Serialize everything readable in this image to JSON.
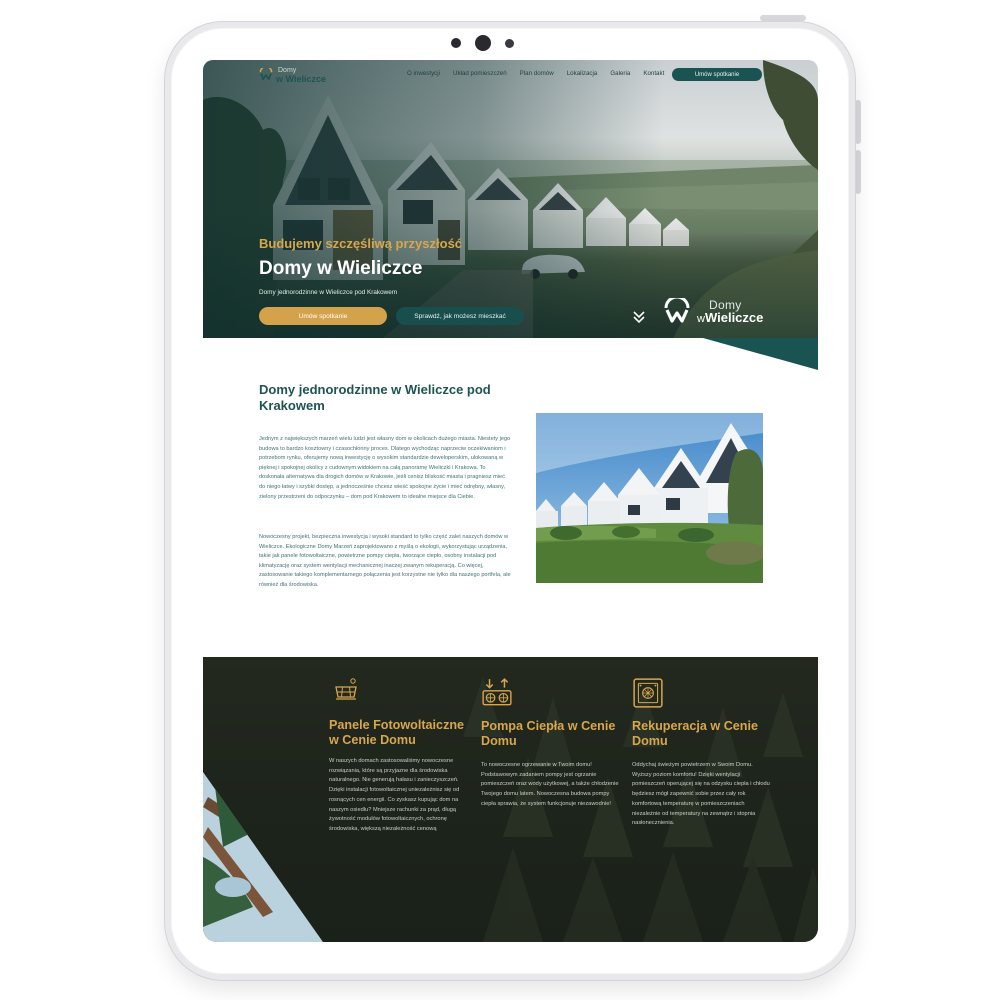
{
  "brand": {
    "word_top": "Domy",
    "word_bottom_prefix": "w",
    "word_bottom": "Wieliczce",
    "colors": {
      "teal": "#1a5452",
      "gold": "#d4a24a",
      "dark": "#1d241b"
    }
  },
  "nav": {
    "links": [
      "O inwestycji",
      "Układ pomieszczeń",
      "Plan domów",
      "Lokalizacja",
      "Galeria",
      "Kontakt"
    ],
    "cta": "Umów spotkanie"
  },
  "hero": {
    "kicker": "Budujemy szczęśliwą przyszłość",
    "title": "Domy w Wieliczce",
    "subtitle": "Domy jednorodzinne w Wieliczce pod Krakowem",
    "primary_button": "Umów spotkanie",
    "secondary_button": "Sprawdź, jak możesz mieszkać",
    "scroll_icon": "double-chevron-down-icon"
  },
  "about": {
    "title": "Domy jednorodzinne w Wieliczce pod Krakowem",
    "paragraph1": "Jednym z największych marzeń wielu ludzi jest własny dom w okolicach dużego miasta. Niestety jego budowa to bardzo kosztowny i czasochłonny proces. Dlatego wychodząc naprzeciw oczekiwaniom i potrzebom rynku, oferujemy nową inwestycję o wysokim standardzie deweloperskim, ulokowaną w pięknej i spokojnej okolicy z cudownym widokiem na całą panoramę Wieliczki i Krakowa. To doskonała alternatywa dla drogich domów w Krakowie, jeśli cenisz bliskość miasta i pragniesz mieć do niego łatwy i szybki dostęp, a jednocześnie chcesz wieść spokojne życie i mieć odrębny, własny, zielony przestrzeni do odpoczynku – dom pod Krakowem to idealne miejsce dla Ciebie.",
    "paragraph2": "Nowoczesny projekt, bezpieczna inwestycja i wysoki standard to tylko część zalet naszych domów w Wieliczce. Ekologiczne Domy Marzeń zaprojektowano z myślą o ekologii, wykorzystując urządzenia, takie jak panele fotowoltaiczne, powietrzne pompy ciepła, tworzące ciepło, osobny instalacji pod klimatyzację oraz system wentylacji mechanicznej inaczej zwanym rekuperacją. Co więcej, zastosowanie takiego komplementarnego połączenia jest korzystne nie tylko dla naszego portfela, ale również dla środowiska."
  },
  "features": [
    {
      "icon": "solar-panel-icon",
      "title": "Panele Fotowoltaiczne w Cenie Domu",
      "text": "W naszych domach zastosowaliśmy nowoczesne rozwiązania, które są przyjazne dla środowiska naturalnego. Nie generują hałasu i zanieczyszczeń. Dzięki instalacji fotowoltaicznej uniezależnisz się od rosnących cen energii. Co zyskasz kupując dom na naszym osiedlu? Mniejsze rachunki za prąd, długą żywotność modułów fotowoltaicznych, ochronę środowiska, większą niezależność cenową"
    },
    {
      "icon": "heat-pump-icon",
      "title": "Pompa Ciepła w Cenie Domu",
      "text": "To nowoczesne ogrzewanie w Twoim domu! Podstawowym zadaniem pompy jest ogrzanie pomieszczeń oraz wody użytkowej, a także chłodzenie Twojego domu latem. Nowoczesna budowa pompy ciepła sprawia, że system funkcjonuje niezawodnie!"
    },
    {
      "icon": "recuperation-unit-icon",
      "title": "Rekuperacja w Cenie Domu",
      "text": "Oddychaj świeżym powietrzem w Swoim Domu. Wyższy poziom komfortu! Dzięki wentylacji pomieszczeń operującej się na odzysku ciepła i chłodu będziesz mógł zapewnić sobie przez cały rok komfortową temperaturę w pomieszczeniach niezależnie od temperatury na zewnątrz i stopnia nasłonecznienia."
    }
  ]
}
